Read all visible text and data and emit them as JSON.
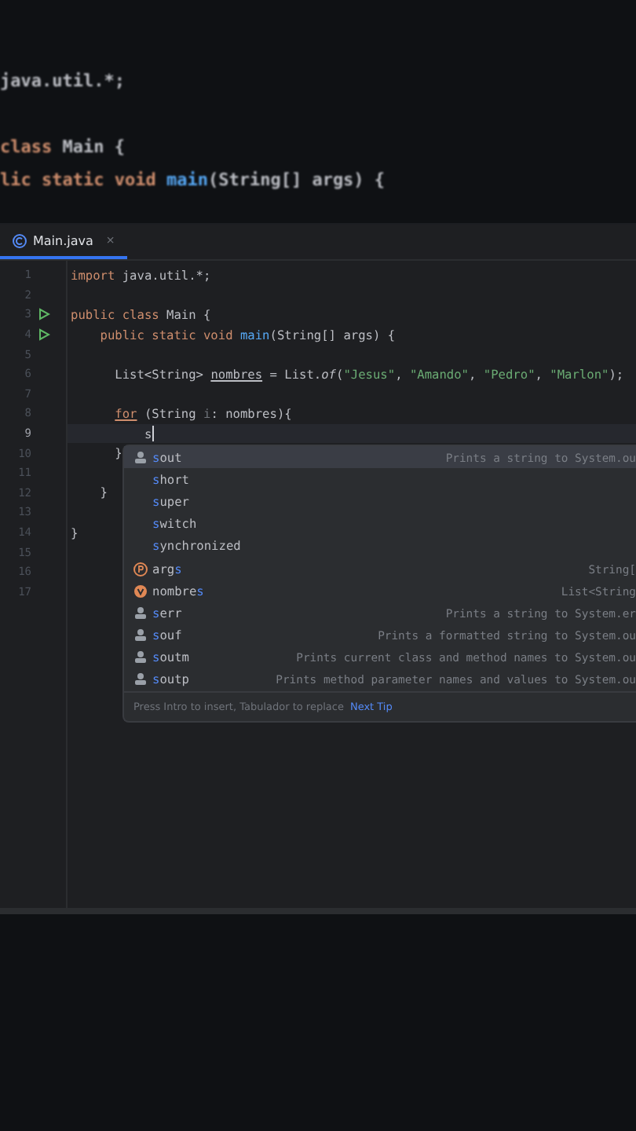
{
  "backdrop_lines": [
    {
      "gap_before": false,
      "tokens": [
        {
          "text": "java.util.*;",
          "kind": "plain"
        }
      ]
    },
    {
      "gap_before": true,
      "tokens": [
        {
          "text": "class ",
          "kind": "keyword"
        },
        {
          "text": "Main {",
          "kind": "plain"
        }
      ]
    },
    {
      "gap_before": false,
      "tokens": [
        {
          "text": "lic static void ",
          "kind": "keyword"
        },
        {
          "text": "main",
          "kind": "method"
        },
        {
          "text": "(String[] args) {",
          "kind": "plain"
        }
      ]
    }
  ],
  "tabs": [
    {
      "label": "Main.java",
      "selected": true,
      "close": "×"
    }
  ],
  "code_lines": [
    {
      "number": "1",
      "run": false,
      "current": false,
      "tokens": [
        {
          "text": "import ",
          "kind": "keyword"
        },
        {
          "text": "java.util.*;",
          "kind": "plain"
        }
      ]
    },
    {
      "number": "2",
      "run": false,
      "current": false
    },
    {
      "number": "3",
      "run": true,
      "current": false,
      "tokens": [
        {
          "text": "public class ",
          "kind": "keyword"
        },
        {
          "text": "Main {",
          "kind": "plain"
        }
      ]
    },
    {
      "number": "4",
      "run": true,
      "current": false,
      "tokens": [
        {
          "text": "    public static void ",
          "kind": "keyword"
        },
        {
          "text": "main",
          "kind": "method"
        },
        {
          "text": "(String[] args) {",
          "kind": "plain"
        }
      ]
    },
    {
      "number": "5",
      "run": false,
      "current": false
    },
    {
      "number": "6",
      "run": false,
      "current": false,
      "tokens": [
        {
          "text": "      List<String> ",
          "kind": "plain"
        },
        {
          "text": "nombres",
          "kind": "warn"
        },
        {
          "text": " = List.",
          "kind": "plain"
        },
        {
          "text": "of",
          "kind": "static"
        },
        {
          "text": "(",
          "kind": "plain"
        },
        {
          "text": "\"Jesus\"",
          "kind": "string"
        },
        {
          "text": ", ",
          "kind": "plain"
        },
        {
          "text": "\"Amando\"",
          "kind": "string"
        },
        {
          "text": ", ",
          "kind": "plain"
        },
        {
          "text": "\"Pedro\"",
          "kind": "string"
        },
        {
          "text": ", ",
          "kind": "plain"
        },
        {
          "text": "\"Marlon\"",
          "kind": "string"
        },
        {
          "text": ");",
          "kind": "plain"
        }
      ]
    },
    {
      "number": "7",
      "run": false,
      "current": false
    },
    {
      "number": "8",
      "run": false,
      "current": false,
      "tokens": [
        {
          "text": "      for",
          "kind": "keyword-warn"
        },
        {
          "text": " (String ",
          "kind": "plain"
        },
        {
          "text": "i",
          "kind": "unused"
        },
        {
          "text": ": nombres){",
          "kind": "plain"
        }
      ]
    },
    {
      "number": "9",
      "run": false,
      "current": true,
      "tokens": [
        {
          "text": "          s",
          "kind": "plain"
        }
      ]
    },
    {
      "number": "10",
      "run": false,
      "current": false,
      "tokens": [
        {
          "text": "      }",
          "kind": "plain"
        }
      ]
    },
    {
      "number": "11",
      "run": false,
      "current": false
    },
    {
      "number": "12",
      "run": false,
      "current": false,
      "tokens": [
        {
          "text": "    }",
          "kind": "plain"
        }
      ]
    },
    {
      "number": "13",
      "run": false,
      "current": false
    },
    {
      "number": "14",
      "run": false,
      "current": false,
      "tokens": [
        {
          "text": "}",
          "kind": "plain"
        }
      ]
    },
    {
      "number": "15",
      "run": false,
      "current": false
    },
    {
      "number": "16",
      "run": false,
      "current": false
    },
    {
      "number": "17",
      "run": false,
      "current": false
    }
  ],
  "completion": {
    "items": [
      {
        "kind": "template",
        "selected": true,
        "parts": [
          {
            "text": "s",
            "match": true
          },
          {
            "text": "out",
            "match": false
          }
        ],
        "detail": "Prints a string to System.ou"
      },
      {
        "kind": "keyword",
        "selected": false,
        "parts": [
          {
            "text": "s",
            "match": true
          },
          {
            "text": "hort",
            "match": false
          }
        ]
      },
      {
        "kind": "keyword",
        "selected": false,
        "parts": [
          {
            "text": "s",
            "match": true
          },
          {
            "text": "uper",
            "match": false
          }
        ]
      },
      {
        "kind": "keyword",
        "selected": false,
        "parts": [
          {
            "text": "s",
            "match": true
          },
          {
            "text": "witch",
            "match": false
          }
        ]
      },
      {
        "kind": "keyword",
        "selected": false,
        "parts": [
          {
            "text": "s",
            "match": true
          },
          {
            "text": "ynchronized",
            "match": false
          }
        ]
      },
      {
        "kind": "parameter",
        "selected": false,
        "parts": [
          {
            "text": "arg",
            "match": false
          },
          {
            "text": "s",
            "match": true
          }
        ],
        "detail": "String["
      },
      {
        "kind": "variable",
        "selected": false,
        "parts": [
          {
            "text": "nombre",
            "match": false
          },
          {
            "text": "s",
            "match": true
          }
        ],
        "detail": "List<String"
      },
      {
        "kind": "template",
        "selected": false,
        "parts": [
          {
            "text": "s",
            "match": true
          },
          {
            "text": "err",
            "match": false
          }
        ],
        "detail": "Prints a string to System.er"
      },
      {
        "kind": "template",
        "selected": false,
        "parts": [
          {
            "text": "s",
            "match": true
          },
          {
            "text": "ouf",
            "match": false
          }
        ],
        "detail": "Prints a formatted string to System.ou"
      },
      {
        "kind": "template",
        "selected": false,
        "parts": [
          {
            "text": "s",
            "match": true
          },
          {
            "text": "outm",
            "match": false
          }
        ],
        "detail": "Prints current class and method names to System.ou"
      },
      {
        "kind": "template",
        "selected": false,
        "parts": [
          {
            "text": "s",
            "match": true
          },
          {
            "text": "outp",
            "match": false
          }
        ],
        "detail": "Prints method parameter names and values to System.ou"
      }
    ],
    "hint": "Press Intro to insert, Tabulador to replace",
    "tip_link": "Next Tip"
  }
}
